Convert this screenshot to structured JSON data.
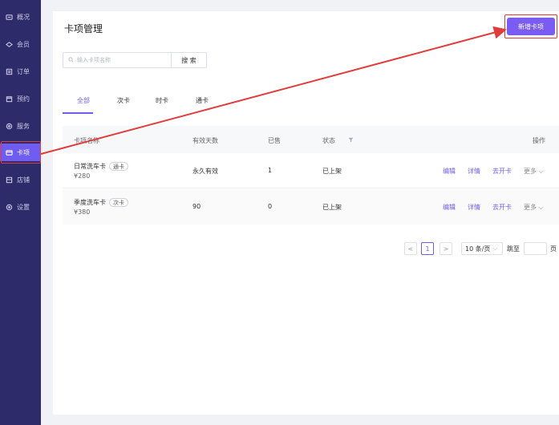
{
  "sidebar": {
    "items": [
      {
        "label": "概况",
        "icon": "dashboard-icon"
      },
      {
        "label": "会员",
        "icon": "member-icon"
      },
      {
        "label": "订单",
        "icon": "order-icon"
      },
      {
        "label": "预约",
        "icon": "calendar-icon"
      },
      {
        "label": "服务",
        "icon": "service-icon"
      },
      {
        "label": "卡项",
        "icon": "card-icon"
      },
      {
        "label": "店铺",
        "icon": "shop-icon"
      },
      {
        "label": "设置",
        "icon": "gear-icon"
      }
    ],
    "active_index": 5
  },
  "page": {
    "title": "卡项管理",
    "add_button": "新增卡项"
  },
  "search": {
    "placeholder": "输入卡项名称",
    "button": "搜 索"
  },
  "tabs": [
    "全部",
    "次卡",
    "时卡",
    "通卡"
  ],
  "table": {
    "headers": [
      "卡项名称",
      "有效天数",
      "已售",
      "状态",
      "操作"
    ],
    "rows": [
      {
        "name": "日常洗车卡",
        "type": "通卡",
        "price": "¥280",
        "days": "永久有效",
        "sold": "1",
        "status": "已上架",
        "actions": [
          "编辑",
          "详情",
          "去开卡"
        ],
        "more": "更多"
      },
      {
        "name": "季度洗车卡",
        "type": "次卡",
        "price": "¥380",
        "days": "90",
        "sold": "0",
        "status": "已上架",
        "actions": [
          "编辑",
          "详情",
          "去开卡"
        ],
        "more": "更多"
      }
    ]
  },
  "pagination": {
    "prev": "<",
    "current": "1",
    "next": ">",
    "page_size": "10 条/页",
    "jump_label": "跳至",
    "page_unit": "页"
  },
  "colors": {
    "sidebar_bg": "#2e2b6b",
    "accent": "#7b5cf2",
    "annotation": "#e23b3b"
  }
}
